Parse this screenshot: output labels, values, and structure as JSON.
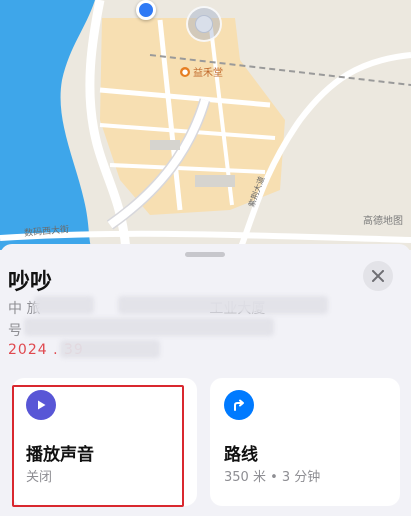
{
  "map": {
    "poi_label": "益禾堂",
    "road_left": "数码西大街",
    "road_right": "紫荆大道",
    "brand": "高德地图"
  },
  "sheet": {
    "title": "吵吵",
    "address_line1": "中  旅",
    "address_line1_tail": "工业大厦",
    "address_line2": "号",
    "time": "2024 . 39"
  },
  "actions": {
    "play_sound": {
      "title": "播放声音",
      "subtitle": "关闭"
    },
    "route": {
      "title": "路线",
      "subtitle": "350 米 • 3 分钟"
    }
  },
  "colors": {
    "play_icon_bg": "#5856d6",
    "route_icon_bg": "#007aff",
    "highlight_border": "#d9282f",
    "time_text": "#e0494f"
  }
}
